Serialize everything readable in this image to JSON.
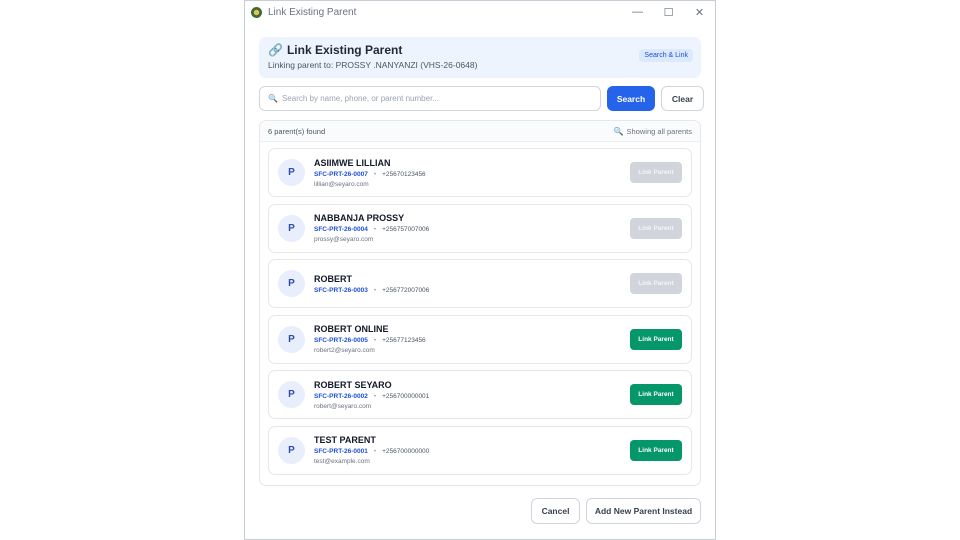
{
  "window": {
    "title": "Link Existing Parent",
    "icon": "app-logo-icon",
    "controls": {
      "minimize": "—",
      "maximize": "☐",
      "close": "✕"
    }
  },
  "header": {
    "title": "Link Existing Parent",
    "icon": "link-icon",
    "subtitle": "Linking parent to: PROSSY .NANYANZI (VHS-26-0648)",
    "chip": "Search & Link"
  },
  "search": {
    "icon": "search-icon",
    "value": "",
    "placeholder": "Search by name, phone, or parent number...",
    "search_label": "Search",
    "clear_label": "Clear"
  },
  "results": {
    "count_text": "6 parent(s) found",
    "filter_icon": "search-icon",
    "filter_text": "Showing all parents",
    "separator": "•",
    "parents": [
      {
        "initial": "P",
        "name": "ASIIMWE LILLIAN",
        "code": "SFC-PRT-26-0007",
        "phone": "+25670123456",
        "email": "lillian@seyaro.com",
        "button": "Link Parent",
        "enabled": false
      },
      {
        "initial": "P",
        "name": "NABBANJA PROSSY",
        "code": "SFC-PRT-26-0004",
        "phone": "+256757007006",
        "email": "prossy@seyaro.com",
        "button": "Link Parent",
        "enabled": false
      },
      {
        "initial": "P",
        "name": "ROBERT",
        "code": "SFC-PRT-26-0003",
        "phone": "+256772007006",
        "email": "",
        "button": "Link Parent",
        "enabled": false
      },
      {
        "initial": "P",
        "name": "ROBERT ONLINE",
        "code": "SFC-PRT-26-0005",
        "phone": "+25677123456",
        "email": "robert2@seyaro.com",
        "button": "Link Parent",
        "enabled": true
      },
      {
        "initial": "P",
        "name": "ROBERT SEYARO",
        "code": "SFC-PRT-26-0002",
        "phone": "+256700000001",
        "email": "robert@seyaro.com",
        "button": "Link Parent",
        "enabled": true
      },
      {
        "initial": "P",
        "name": "TEST PARENT",
        "code": "SFC-PRT-26-0001",
        "phone": "+256700000000",
        "email": "test@example.com",
        "button": "Link Parent",
        "enabled": true
      }
    ]
  },
  "footer": {
    "cancel_label": "Cancel",
    "add_label": "Add New Parent Instead"
  },
  "colors": {
    "primary": "#2563eb",
    "success": "#059669",
    "disabled": "#d1d5db",
    "header_bg": "#eef4fd"
  }
}
